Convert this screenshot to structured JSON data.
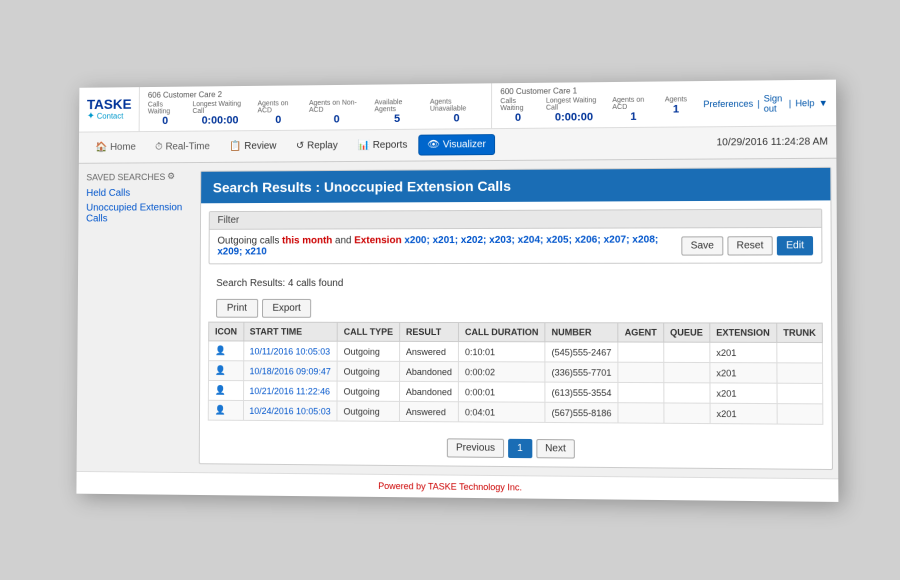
{
  "header": {
    "logo": "TASKE",
    "logo_sub": "Contact",
    "group1": {
      "title": "606 Customer Care 2",
      "stats": [
        {
          "label": "Calls Waiting",
          "value": "0"
        },
        {
          "label": "Longest Waiting Call",
          "value": "0:00:00"
        },
        {
          "label": "Agents on ACD",
          "value": "0"
        },
        {
          "label": "Agents on Non-ACD",
          "value": "0"
        },
        {
          "label": "Available Agents",
          "value": "5"
        },
        {
          "label": "Agents Unavailable",
          "value": "0"
        }
      ]
    },
    "group2": {
      "title": "600 Customer Care 1",
      "stats": [
        {
          "label": "Calls Waiting",
          "value": "0"
        },
        {
          "label": "Longest Waiting Call",
          "value": "0:00:00"
        },
        {
          "label": "Agents on ACD",
          "value": "1"
        },
        {
          "label": "Agents",
          "value": "1"
        }
      ]
    },
    "links": [
      "Preferences",
      "Sign out",
      "Help"
    ],
    "timestamp": "10/29/2016 11:24:28 AM"
  },
  "nav": {
    "home_label": "Home",
    "realtime_label": "Real-Time",
    "review_label": "Review",
    "replay_label": "Replay",
    "reports_label": "Reports",
    "visualizer_label": "Visualizer"
  },
  "sidebar": {
    "title": "SAVED SEARCHES",
    "items": [
      {
        "label": "Held Calls"
      },
      {
        "label": "Unoccupied Extension Calls"
      }
    ]
  },
  "main": {
    "page_title": "Search Results : Unoccupied Extension Calls",
    "filter": {
      "label": "Filter",
      "text_parts": [
        {
          "text": "Outgoing calls ",
          "style": "normal"
        },
        {
          "text": "this month",
          "style": "highlight"
        },
        {
          "text": " and ",
          "style": "normal"
        },
        {
          "text": "Extension",
          "style": "highlight"
        },
        {
          "text": " x200; x201; x202; x203; x204; x205; x206; x207; x208; x209; x210",
          "style": "blue"
        }
      ],
      "buttons": [
        "Save",
        "Reset",
        "Edit"
      ]
    },
    "results_count": "Search Results: 4 calls found",
    "action_buttons": [
      "Print",
      "Export"
    ],
    "table": {
      "columns": [
        "ICON",
        "START TIME",
        "CALL TYPE",
        "RESULT",
        "CALL DURATION",
        "NUMBER",
        "AGENT",
        "QUEUE",
        "EXTENSION",
        "TRUNK"
      ],
      "rows": [
        {
          "icon": "👤",
          "start_time": "10/11/2016 10:05:03",
          "call_type": "Outgoing",
          "result": "Answered",
          "duration": "0:10:01",
          "number": "(545)555-2467",
          "agent": "",
          "queue": "",
          "extension": "x201",
          "trunk": ""
        },
        {
          "icon": "👤",
          "start_time": "10/18/2016 09:09:47",
          "call_type": "Outgoing",
          "result": "Abandoned",
          "duration": "0:00:02",
          "number": "(336)555-7701",
          "agent": "",
          "queue": "",
          "extension": "x201",
          "trunk": ""
        },
        {
          "icon": "👤",
          "start_time": "10/21/2016 11:22:46",
          "call_type": "Outgoing",
          "result": "Abandoned",
          "duration": "0:00:01",
          "number": "(613)555-3554",
          "agent": "",
          "queue": "",
          "extension": "x201",
          "trunk": ""
        },
        {
          "icon": "👤",
          "start_time": "10/24/2016 10:05:03",
          "call_type": "Outgoing",
          "result": "Answered",
          "duration": "0:04:01",
          "number": "(567)555-8186",
          "agent": "",
          "queue": "",
          "extension": "x201",
          "trunk": ""
        }
      ]
    },
    "pagination": {
      "prev": "Previous",
      "current": "1",
      "next": "Next"
    }
  },
  "footer": {
    "text": "Powered by TASKE Technology Inc."
  }
}
